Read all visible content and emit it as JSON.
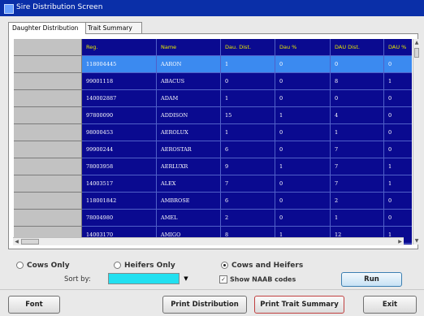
{
  "window": {
    "title": "Sire Distribution Screen"
  },
  "tabs": [
    {
      "label": "Daughter Distribution",
      "active": true
    },
    {
      "label": "Trait Summary",
      "active": false
    }
  ],
  "grid": {
    "columns": [
      "Reg.",
      "Name",
      "Dau. Dist.",
      "Dau %",
      "DAU Dist.",
      "DAU %"
    ],
    "selected_row": 0,
    "rows": [
      [
        "118004445",
        "AARON",
        "1",
        "0",
        "0",
        "0"
      ],
      [
        "99001118",
        "ABACUS",
        "0",
        "0",
        "8",
        "1"
      ],
      [
        "140002887",
        "ADAM",
        "1",
        "0",
        "0",
        "0"
      ],
      [
        "97800090",
        "ADDISON",
        "15",
        "1",
        "4",
        "0"
      ],
      [
        "98000453",
        "AEROLUX",
        "1",
        "0",
        "1",
        "0"
      ],
      [
        "99900244",
        "AEROSTAR",
        "6",
        "0",
        "7",
        "0"
      ],
      [
        "78003958",
        "AERLUXR",
        "9",
        "1",
        "7",
        "1"
      ],
      [
        "14003517",
        "ALEX",
        "7",
        "0",
        "7",
        "1"
      ],
      [
        "118001842",
        "AMBROSE",
        "6",
        "0",
        "2",
        "0"
      ],
      [
        "78004980",
        "AMEL",
        "2",
        "0",
        "1",
        "0"
      ],
      [
        "14003170",
        "AMIGO",
        "8",
        "1",
        "12",
        "1"
      ]
    ]
  },
  "options": {
    "radio": [
      {
        "label": "Cows Only",
        "selected": false
      },
      {
        "label": "Heifers Only",
        "selected": false
      },
      {
        "label": "Cows and Heifers",
        "selected": true
      }
    ],
    "sort_label": "Sort by:",
    "sort_value": "",
    "naab_label": "Show NAAB codes",
    "naab_checked": true
  },
  "buttons": {
    "run": "Run",
    "font": "Font",
    "print_distribution": "Print Distribution",
    "print_trait_summary": "Print Trait Summary",
    "exit": "Exit"
  },
  "colors": {
    "grid_bg": "#0a0a90",
    "header_text": "#e8e800",
    "selected_row": "#3b8af0",
    "sort_field": "#22e0f0",
    "titlebar": "#0a2fa8"
  }
}
